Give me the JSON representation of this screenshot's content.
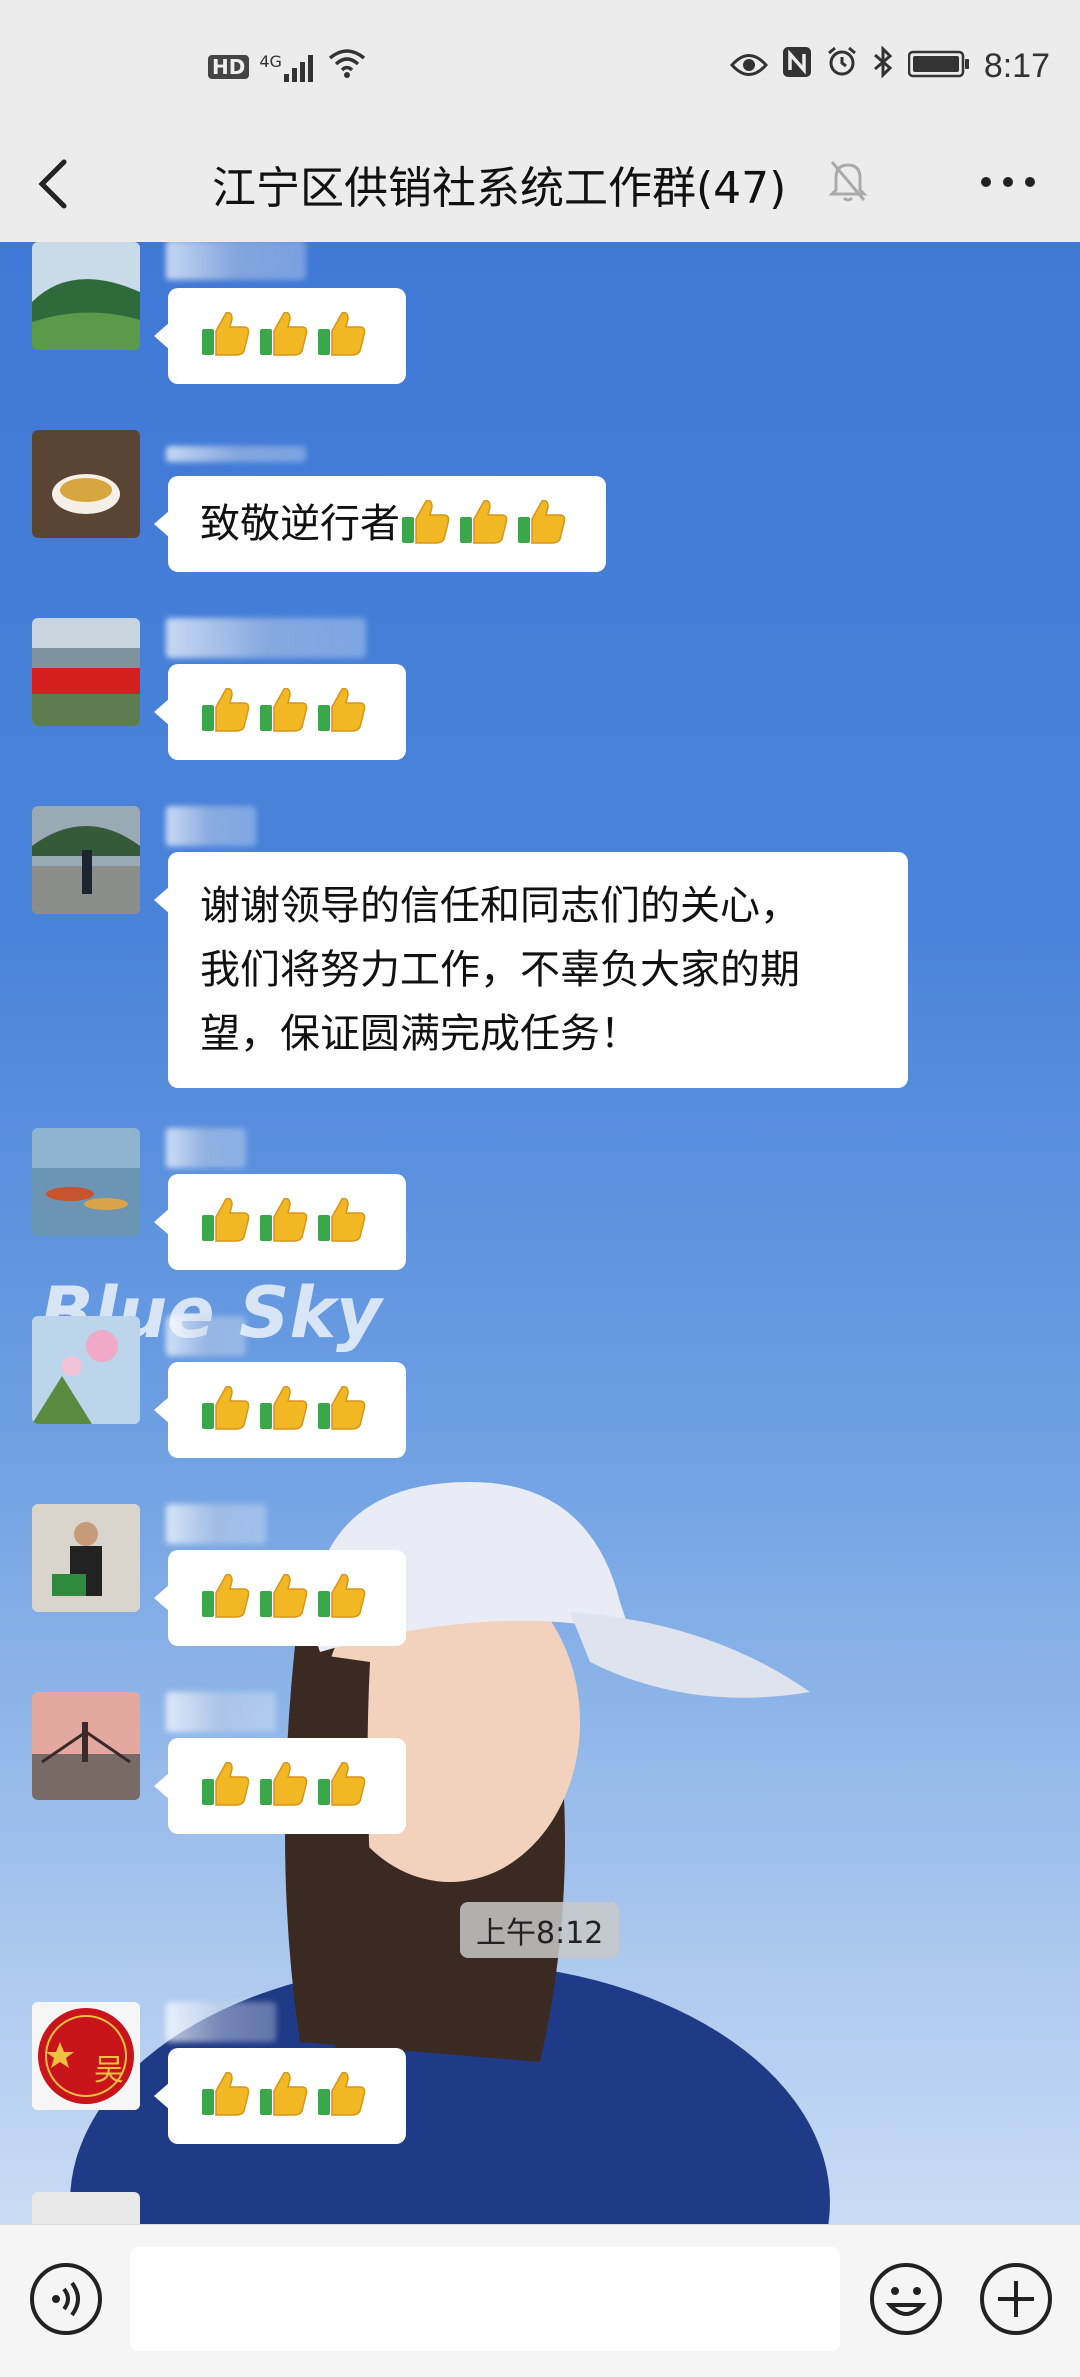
{
  "status_bar": {
    "network_hd": "HD",
    "network_type": "4G",
    "time": "8:17"
  },
  "header": {
    "title": "江宁区供销社系统工作群(47)"
  },
  "chat": {
    "background_text": "Blue Sky",
    "messages": [
      {
        "type": "emoji",
        "text": "",
        "emoji_count": 3
      },
      {
        "type": "text",
        "text": "致敬逆行者",
        "emoji_count": 3
      },
      {
        "type": "emoji",
        "text": "",
        "emoji_count": 3
      },
      {
        "type": "text",
        "lines": [
          "谢谢领导的信任和同志们的关心，",
          "我们将努力工作，不辜负大家的期",
          "望，保证圆满完成任务！"
        ]
      },
      {
        "type": "emoji",
        "text": "",
        "emoji_count": 3
      },
      {
        "type": "emoji",
        "text": "",
        "emoji_count": 3
      },
      {
        "type": "emoji",
        "text": "",
        "emoji_count": 3
      },
      {
        "type": "emoji",
        "text": "",
        "emoji_count": 3
      },
      {
        "type": "emoji",
        "text": "",
        "emoji_count": 3
      }
    ],
    "timestamp": "上午8:12",
    "avatar_seal_text": "吴"
  },
  "colors": {
    "bar_bg": "#ececec",
    "bubble_bg": "#ffffff",
    "sky_top": "#3f78d6"
  },
  "icons": [
    "back-arrow-icon",
    "mute-bell-icon",
    "more-icon",
    "voice-icon",
    "emoji-icon",
    "plus-icon",
    "thumbs-up-icon"
  ]
}
